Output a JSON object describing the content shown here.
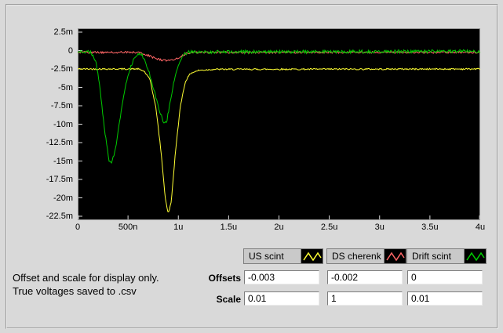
{
  "note": {
    "line1": "Offset and scale for display only.",
    "line2": "True voltages saved to .csv"
  },
  "controls": {
    "offsets_label": "Offsets",
    "scale_label": "Scale",
    "offsets": [
      "-0.003",
      "-0.002",
      "0"
    ],
    "scale": [
      "0.01",
      "1",
      "0.01"
    ]
  },
  "chart_data": {
    "type": "line",
    "title": "",
    "xlabel": "",
    "ylabel": "",
    "xlim": [
      0,
      4
    ],
    "ylim": [
      -22.5,
      2.5
    ],
    "grid": false,
    "legend_position": "bottom-right",
    "plot_bg": "#000000",
    "x_unit": "seconds (ticks shown in n/u suffix)",
    "y_unit": "volts (ticks shown in milli)",
    "x_ticks": [
      {
        "v": 0.0,
        "label": "0"
      },
      {
        "v": 0.5,
        "label": "500n"
      },
      {
        "v": 1.0,
        "label": "1u"
      },
      {
        "v": 1.5,
        "label": "1.5u"
      },
      {
        "v": 2.0,
        "label": "2u"
      },
      {
        "v": 2.5,
        "label": "2.5u"
      },
      {
        "v": 3.0,
        "label": "3u"
      },
      {
        "v": 3.5,
        "label": "3.5u"
      },
      {
        "v": 4.0,
        "label": "4u"
      }
    ],
    "y_ticks": [
      {
        "v": 2.5,
        "label": "2.5m"
      },
      {
        "v": 0,
        "label": "0"
      },
      {
        "v": -2.5,
        "label": "-2.5m"
      },
      {
        "v": -5,
        "label": "-5m"
      },
      {
        "v": -7.5,
        "label": "-7.5m"
      },
      {
        "v": -10,
        "label": "-10m"
      },
      {
        "v": -12.5,
        "label": "-12.5m"
      },
      {
        "v": -15,
        "label": "-15m"
      },
      {
        "v": -17.5,
        "label": "-17.5m"
      },
      {
        "v": -20,
        "label": "-20m"
      },
      {
        "v": -22.5,
        "label": "-22.5m"
      }
    ],
    "series": [
      {
        "name": "US scint",
        "color": "#ffff33",
        "noise": 0.1,
        "keypoints": [
          [
            0,
            -2.5
          ],
          [
            0.6,
            -2.5
          ],
          [
            0.66,
            -2.8
          ],
          [
            0.72,
            -4.0
          ],
          [
            0.78,
            -8.0
          ],
          [
            0.83,
            -14.0
          ],
          [
            0.87,
            -20.0
          ],
          [
            0.9,
            -22.2
          ],
          [
            0.93,
            -20.5
          ],
          [
            0.97,
            -14.0
          ],
          [
            1.02,
            -7.5
          ],
          [
            1.07,
            -4.2
          ],
          [
            1.12,
            -3.1
          ],
          [
            1.2,
            -2.7
          ],
          [
            1.35,
            -2.55
          ],
          [
            4,
            -2.5
          ]
        ]
      },
      {
        "name": "DS cherenk",
        "color": "#ff6666",
        "noise": 0.13,
        "keypoints": [
          [
            0,
            -0.25
          ],
          [
            0.6,
            -0.25
          ],
          [
            0.68,
            -0.55
          ],
          [
            0.76,
            -1.0
          ],
          [
            0.85,
            -1.35
          ],
          [
            0.95,
            -1.3
          ],
          [
            1.02,
            -0.85
          ],
          [
            1.08,
            -0.4
          ],
          [
            1.15,
            -0.25
          ],
          [
            4,
            -0.25
          ]
        ]
      },
      {
        "name": "Drift scint",
        "color": "#00cc00",
        "noise": 0.22,
        "keypoints": [
          [
            0,
            -0.1
          ],
          [
            0.13,
            -0.2
          ],
          [
            0.18,
            -1.5
          ],
          [
            0.22,
            -5.0
          ],
          [
            0.27,
            -11.0
          ],
          [
            0.31,
            -14.8
          ],
          [
            0.34,
            -15.2
          ],
          [
            0.38,
            -13.0
          ],
          [
            0.43,
            -8.5
          ],
          [
            0.48,
            -4.5
          ],
          [
            0.53,
            -2.0
          ],
          [
            0.58,
            -0.7
          ],
          [
            0.62,
            -0.3
          ],
          [
            0.66,
            -1.0
          ],
          [
            0.71,
            -3.0
          ],
          [
            0.76,
            -5.5
          ],
          [
            0.81,
            -8.0
          ],
          [
            0.85,
            -9.7
          ],
          [
            0.88,
            -9.9
          ],
          [
            0.92,
            -7.0
          ],
          [
            0.96,
            -4.0
          ],
          [
            1.0,
            -1.8
          ],
          [
            1.05,
            -0.6
          ],
          [
            1.1,
            -0.2
          ],
          [
            4,
            -0.1
          ]
        ]
      }
    ]
  }
}
